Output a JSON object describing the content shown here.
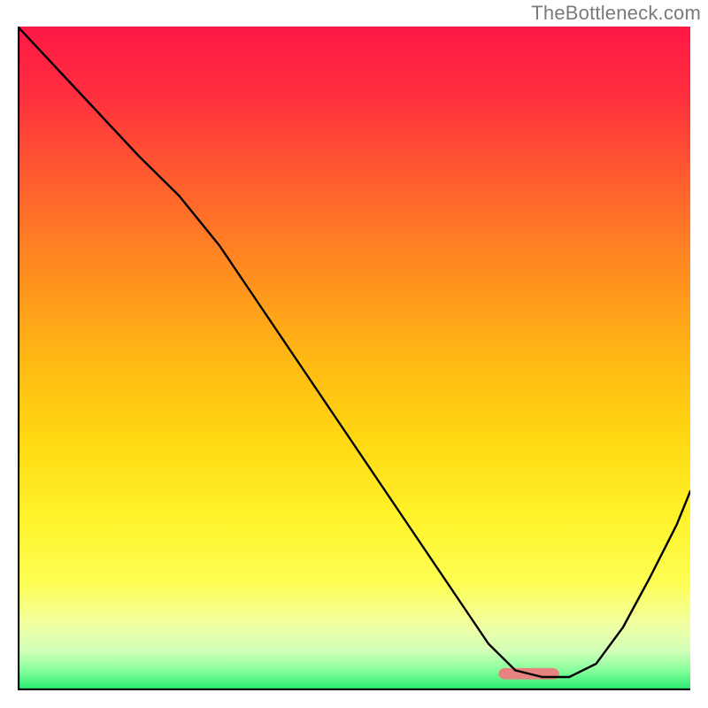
{
  "watermark": "TheBottleneck.com",
  "gradient": {
    "stops": [
      {
        "offset": 0.0,
        "color": "#ff1846"
      },
      {
        "offset": 0.1,
        "color": "#ff2e3f"
      },
      {
        "offset": 0.22,
        "color": "#ff5a30"
      },
      {
        "offset": 0.36,
        "color": "#ff8a20"
      },
      {
        "offset": 0.5,
        "color": "#ffb814"
      },
      {
        "offset": 0.62,
        "color": "#ffd812"
      },
      {
        "offset": 0.74,
        "color": "#fff32a"
      },
      {
        "offset": 0.84,
        "color": "#fdff55"
      },
      {
        "offset": 0.9,
        "color": "#f1ffa2"
      },
      {
        "offset": 0.94,
        "color": "#d3ffb8"
      },
      {
        "offset": 0.97,
        "color": "#87ff9c"
      },
      {
        "offset": 1.0,
        "color": "#21e86d"
      }
    ]
  },
  "marker": {
    "x_norm": 0.76,
    "y_norm": 0.975,
    "w_norm": 0.09,
    "h_norm": 0.017,
    "rx": 7,
    "fill": "#e6827f"
  },
  "axes": {
    "color": "#000000",
    "width": 2.2
  },
  "chart_data": {
    "type": "line",
    "title": "",
    "xlabel": "",
    "ylabel": "",
    "xlim": [
      0,
      1
    ],
    "ylim": [
      0,
      1
    ],
    "series": [
      {
        "name": "bottleneck-curve",
        "color": "#000000",
        "width": 2.4,
        "x": [
          0.0,
          0.06,
          0.12,
          0.18,
          0.24,
          0.3,
          0.36,
          0.42,
          0.48,
          0.54,
          0.6,
          0.66,
          0.7,
          0.74,
          0.78,
          0.82,
          0.86,
          0.9,
          0.94,
          0.98,
          1.0
        ],
        "y": [
          1.0,
          0.935,
          0.87,
          0.805,
          0.745,
          0.67,
          0.58,
          0.49,
          0.4,
          0.31,
          0.22,
          0.13,
          0.07,
          0.03,
          0.02,
          0.02,
          0.04,
          0.095,
          0.17,
          0.25,
          0.3
        ]
      }
    ],
    "annotations": []
  }
}
